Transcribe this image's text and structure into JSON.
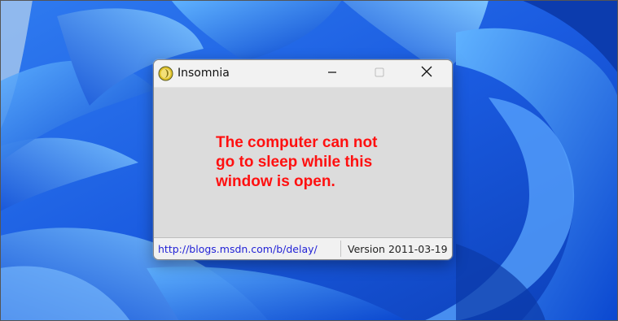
{
  "window": {
    "title": "Insomnia",
    "icon": "insomnia-moon-icon",
    "controls": {
      "minimize": "minimize-icon",
      "maximize": "maximize-icon",
      "close": "close-icon"
    }
  },
  "content": {
    "message_lines": [
      "The computer can not",
      "go to sleep while this",
      "window is open."
    ],
    "message_color": "#ff1010"
  },
  "statusbar": {
    "link": "http://blogs.msdn.com/b/delay/",
    "version": "Version 2011-03-19"
  },
  "desktop": {
    "wallpaper": "windows-11-bloom",
    "accent": "#1e5fe0"
  }
}
